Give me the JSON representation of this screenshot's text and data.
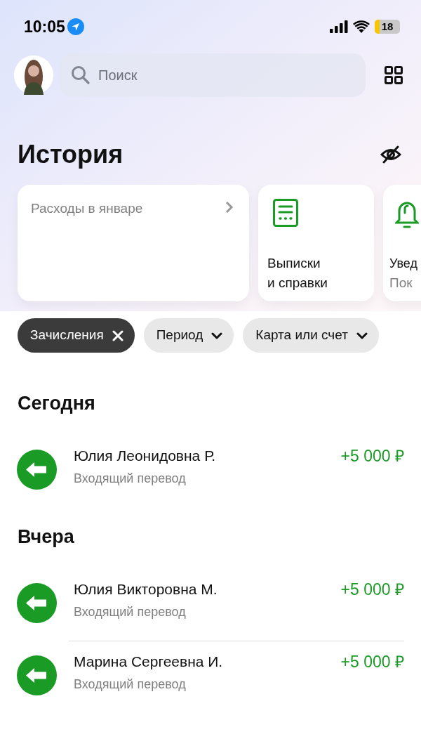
{
  "status_bar": {
    "time": "10:05",
    "battery": "18"
  },
  "search": {
    "placeholder": "Поиск"
  },
  "title": "История",
  "cards": [
    {
      "kind": "expenses",
      "title": "Расходы в январе"
    },
    {
      "kind": "statements",
      "title": "Выписки\nи справки"
    },
    {
      "kind": "notifications",
      "title": "Увед",
      "subtitle": "Пок"
    }
  ],
  "filters": [
    {
      "label": "Зачисления",
      "kind": "removable",
      "selected": true
    },
    {
      "label": "Период",
      "kind": "dropdown",
      "selected": false
    },
    {
      "label": "Карта или счет",
      "kind": "dropdown",
      "selected": false
    }
  ],
  "sections": [
    {
      "title": "Сегодня",
      "items": [
        {
          "name": "Юлия Леонидовна Р.",
          "type": "Входящий перевод",
          "amount": "+5 000 ₽"
        }
      ]
    },
    {
      "title": "Вчера",
      "items": [
        {
          "name": "Юлия Викторовна М.",
          "type": "Входящий перевод",
          "amount": "+5 000 ₽"
        },
        {
          "name": "Марина Сергеевна И.",
          "type": "Входящий перевод",
          "amount": "+5 000 ₽"
        }
      ]
    }
  ]
}
